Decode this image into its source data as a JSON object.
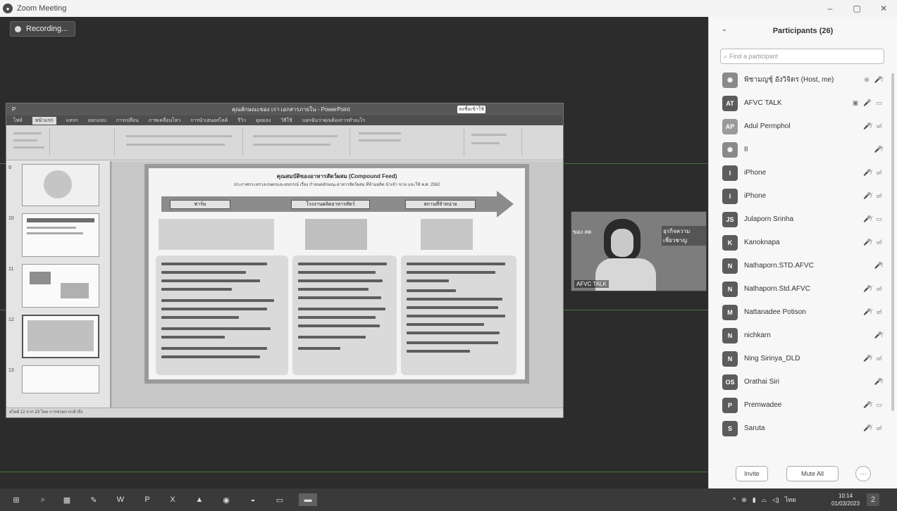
{
  "window": {
    "title": "Zoom Meeting",
    "controls": [
      "–",
      "▢",
      "✕"
    ]
  },
  "recording": {
    "label": "Recording..."
  },
  "shared_screen": {
    "ppt_title": "คุณลักษณะของ เรา เอกสารภายใน - PowerPoint",
    "ppt_button": "ลงชื่อเข้าใช้",
    "ppt_tabs": [
      "ไฟล์",
      "หน้าแรก",
      "แทรก",
      "ออกแบบ",
      "การเปลี่ยน",
      "ภาพเคลื่อนไหว",
      "การนำเสนอสไลด์",
      "รีวิว",
      "มุมมอง",
      "วิธีใช้",
      "บอกฉันว่าคุณต้องการทำอะไร"
    ],
    "slide_numbers": [
      "9",
      "10",
      "11",
      "12",
      "13"
    ],
    "slide_title": "คุณสมบัติของอาหารสัตว์ผสม (Compound Feed)",
    "slide_subtitle": "ประกาศกระทรวงเกษตรและสหกรณ์ เรื่อง กำหนดลักษณะอาหารสัตว์ผสม ที่ห้ามผลิต นำเข้า ขาย และใช้ พ.ศ. 2562",
    "stage_labels": [
      "ฟาร์ม",
      "โรงงานผลิตอาหารสัตว์",
      "สถานที่จำหน่าย"
    ],
    "status_bar": "สไลด์ 12 จาก 23   ไทย   การช่วยการเข้าถึง"
  },
  "speaker_video": {
    "name": "AFVC TALK",
    "overlay_left": "ของ สต",
    "overlay_right": "ธุรกิจความเชี่ยวชาญ"
  },
  "participants": {
    "title": "Participants (26)",
    "search_placeholder": "Find a participant",
    "list": [
      {
        "initials": "",
        "avatar": "photo",
        "name": "พิชามญชุ์ อังวิจิตร (Host, me)",
        "icons": [
          "⊕",
          "🎤̸"
        ]
      },
      {
        "initials": "AT",
        "avatar": "dark",
        "name": "AFVC TALK",
        "icons": [
          "▣",
          "🎤",
          "▭"
        ]
      },
      {
        "initials": "AP",
        "avatar": "light",
        "name": "Adul Permphol",
        "icons": [
          "🎤̸",
          "▭̸"
        ]
      },
      {
        "initials": "",
        "avatar": "photo",
        "name": "II",
        "icons": [
          "🎤̸"
        ]
      },
      {
        "initials": "I",
        "avatar": "dark",
        "name": "iPhone",
        "icons": [
          "🎤̸",
          "▭̸"
        ]
      },
      {
        "initials": "I",
        "avatar": "dark",
        "name": "iPhone",
        "icons": [
          "🎤̸",
          "▭̸"
        ]
      },
      {
        "initials": "JS",
        "avatar": "dark",
        "name": "Julaporn Srinha",
        "icons": [
          "🎤̸",
          "▭"
        ]
      },
      {
        "initials": "K",
        "avatar": "dark",
        "name": "Kanoknapa",
        "icons": [
          "🎤̸",
          "▭̸"
        ]
      },
      {
        "initials": "N",
        "avatar": "dark",
        "name": "Nathaporn.STD.AFVC",
        "icons": [
          "🎤̸"
        ]
      },
      {
        "initials": "N",
        "avatar": "dark",
        "name": "Nathaporn.Std.AFVC",
        "icons": [
          "🎤̸",
          "▭̸"
        ]
      },
      {
        "initials": "M",
        "avatar": "dark",
        "name": "Nattanadee Potison",
        "icons": [
          "🎤̸",
          "▭̸"
        ]
      },
      {
        "initials": "N",
        "avatar": "dark",
        "name": "nichkarn",
        "icons": [
          "🎤̸"
        ]
      },
      {
        "initials": "N",
        "avatar": "dark",
        "name": "Ning Sirinya_DLD",
        "icons": [
          "🎤̸",
          "▭̸"
        ]
      },
      {
        "initials": "OS",
        "avatar": "dark",
        "name": "Orathai Siri",
        "icons": [
          "🎤̸"
        ]
      },
      {
        "initials": "P",
        "avatar": "dark",
        "name": "Premwadee",
        "icons": [
          "🎤̸",
          "▭"
        ]
      },
      {
        "initials": "S",
        "avatar": "dark",
        "name": "Saruta",
        "icons": [
          "🎤̸",
          "▭̸"
        ]
      }
    ],
    "invite_label": "Invite",
    "mute_all_label": "Mute All",
    "more_label": "···"
  },
  "taskbar": {
    "icons": [
      {
        "name": "start-icon",
        "glyph": "⊞"
      },
      {
        "name": "search-icon",
        "glyph": "⌕"
      },
      {
        "name": "calculator-icon",
        "glyph": "▦"
      },
      {
        "name": "paint-icon",
        "glyph": "✎"
      },
      {
        "name": "word-icon",
        "glyph": "W"
      },
      {
        "name": "powerpoint-icon",
        "glyph": "P"
      },
      {
        "name": "excel-icon",
        "glyph": "X"
      },
      {
        "name": "photos-icon",
        "glyph": "▲"
      },
      {
        "name": "chrome-icon",
        "glyph": "◉"
      },
      {
        "name": "line-icon",
        "glyph": "◒"
      },
      {
        "name": "explorer-icon",
        "glyph": "▭"
      },
      {
        "name": "zoom-icon",
        "glyph": "▬"
      }
    ],
    "language": "ไทย",
    "time": "10:14",
    "date": "01/03/2023",
    "notifications": "2"
  }
}
